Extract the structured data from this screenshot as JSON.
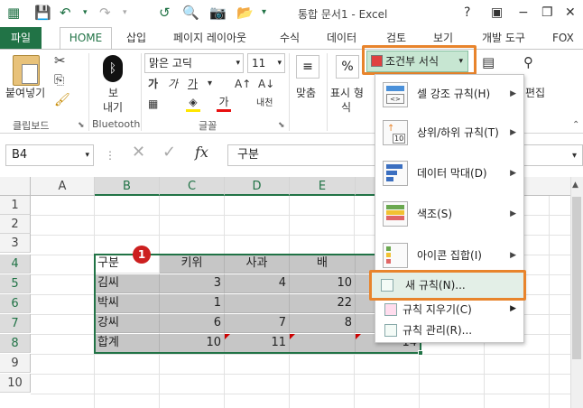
{
  "window": {
    "title": "통합 문서1 - Excel",
    "help": "?",
    "minimize": "−",
    "restore": "❐",
    "close": "✕"
  },
  "tabs": [
    "파일",
    "HOME",
    "삽입",
    "페이지 레이아웃",
    "수식",
    "데이터",
    "검토",
    "보기",
    "개발 도구",
    "FOX"
  ],
  "ribbon": {
    "clipboard": {
      "paste": "붙여넣기",
      "label": "클립보드"
    },
    "bluetooth": {
      "send1": "보",
      "send2": "내기",
      "label": "Bluetooth"
    },
    "font": {
      "name": "맑은 고딕",
      "size": "11",
      "bold": "가",
      "italic": "가",
      "underline": "가",
      "fontcolor": "가",
      "special": "내천",
      "label": "글꼴"
    },
    "align": {
      "label": "맞춤"
    },
    "number": {
      "percent": "%",
      "label1": "표시 형",
      "label2": "식"
    },
    "styles": {
      "conditional_format": "조건부 서식",
      "cut_text": "편집"
    }
  },
  "formula_bar": {
    "name_box": "B4",
    "fx": "fx",
    "content": "구분"
  },
  "columns": [
    "A",
    "B",
    "C",
    "D",
    "E"
  ],
  "rows": [
    "1",
    "2",
    "3",
    "4",
    "5",
    "6",
    "7",
    "8",
    "9",
    "10"
  ],
  "table": {
    "header": [
      "구분",
      "키위",
      "사과",
      "배",
      ""
    ],
    "rows": [
      [
        "김씨",
        "3",
        "4",
        "10",
        ""
      ],
      [
        "박씨",
        "1",
        "",
        "22",
        ""
      ],
      [
        "강씨",
        "6",
        "7",
        "8",
        ""
      ],
      [
        "합계",
        "10",
        "11",
        "",
        "14"
      ]
    ]
  },
  "menu": {
    "items": [
      {
        "label": "셀 강조 규칙(H)"
      },
      {
        "label": "상위/하위 규칙(T)"
      },
      {
        "label": "데이터 막대(D)"
      },
      {
        "label": "색조(S)"
      },
      {
        "label": "아이콘 집합(I)"
      },
      {
        "label": "새 규칙(N)..."
      },
      {
        "label": "규칙 지우기(C)"
      },
      {
        "label": "규칙 관리(R)..."
      }
    ]
  },
  "badge": "1",
  "colors": {
    "excel_green": "#217346",
    "highlight": "#e8842c",
    "selection_shade": "#c6c6c6"
  }
}
